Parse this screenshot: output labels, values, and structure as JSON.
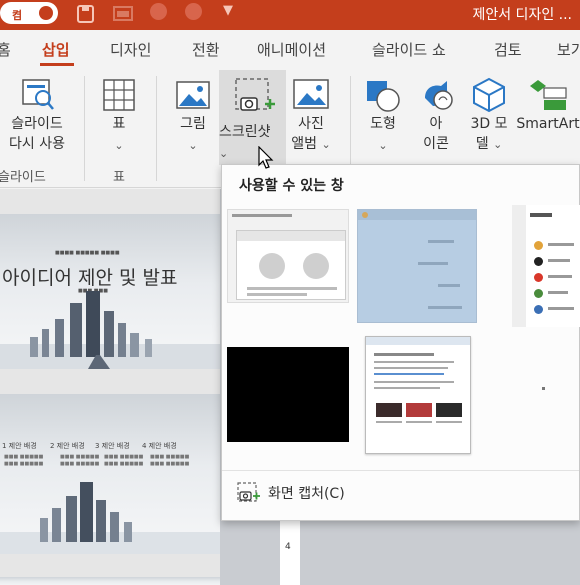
{
  "titlebar": {
    "autosave_label": "켬",
    "document_title": "제안서 디자인 ..."
  },
  "tabs": [
    {
      "label": "홈"
    },
    {
      "label": "삽입"
    },
    {
      "label": "디자인"
    },
    {
      "label": "전환"
    },
    {
      "label": "애니메이션"
    },
    {
      "label": "슬라이드 쇼"
    },
    {
      "label": "검토"
    },
    {
      "label": "보기"
    }
  ],
  "ribbon": {
    "reuse_slides": {
      "line1": "슬라이드",
      "line2": "다시 사용"
    },
    "slides_group_label": "슬라이드",
    "table": {
      "label": "표"
    },
    "table_group_label": "표",
    "pictures": {
      "label": "그림"
    },
    "screenshot": {
      "label": "스크린샷"
    },
    "photo_album": {
      "line1": "사진",
      "line2": "앨범"
    },
    "shapes": {
      "label": "도형"
    },
    "icons": {
      "line1": "아",
      "line2": "이콘"
    },
    "models3d": {
      "line1": "3D 모",
      "line2": "델"
    },
    "smartart": {
      "label": "SmartArt"
    }
  },
  "dropdown": {
    "title": "사용할 수 있는 창",
    "screen_capture_label": "화면 캡처(C)"
  },
  "slides": {
    "slide1_title": "아이디어 제안 및 발표",
    "slide2_headers": [
      "1 제안 배경",
      "2 제안 배경",
      "3 제안 배경",
      "4 제안 배경"
    ]
  },
  "ruler": {
    "mark": "4"
  },
  "colors": {
    "accent": "#c43e1c",
    "ribbon_bg": "#f3f3f3",
    "dropdown_bg": "#fcfcfc"
  }
}
